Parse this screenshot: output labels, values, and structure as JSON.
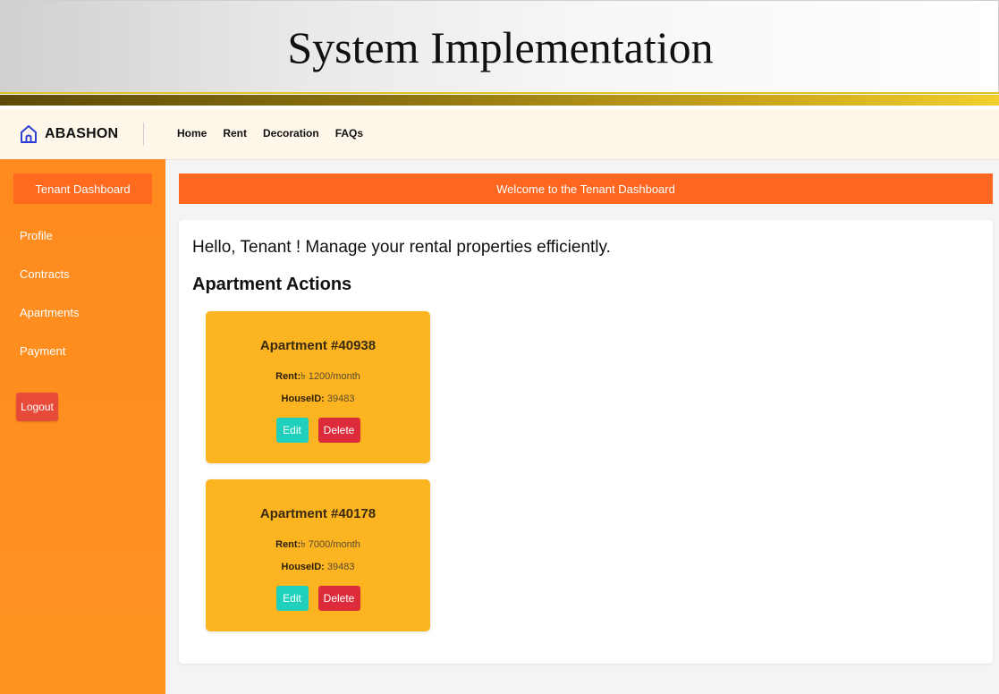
{
  "slide": {
    "title": "System Implementation"
  },
  "brand": {
    "name": "ABASHON",
    "icon": "home-icon"
  },
  "nav": {
    "links": [
      "Home",
      "Rent",
      "Decoration",
      "FAQs"
    ]
  },
  "sidebar": {
    "title": "Tenant Dashboard",
    "items": [
      "Profile",
      "Contracts",
      "Apartments",
      "Payment"
    ],
    "logout": "Logout"
  },
  "welcome": "Welcome to the Tenant Dashboard",
  "main": {
    "greeting": "Hello, Tenant ! Manage your rental properties efficiently.",
    "section_title": "Apartment Actions"
  },
  "apartments": [
    {
      "title": "Apartment #40938",
      "rent_label": "Rent:",
      "rent_value": "৳ 1200/month",
      "house_label": "HouseID:",
      "house_value": "39483",
      "edit": "Edit",
      "delete": "Delete"
    },
    {
      "title": "Apartment #40178",
      "rent_label": "Rent:",
      "rent_value": "৳ 7000/month",
      "house_label": "HouseID:",
      "house_value": "39483",
      "edit": "Edit",
      "delete": "Delete"
    }
  ],
  "colors": {
    "sidebar": "#ff8a1f",
    "accent_orange": "#ff6620",
    "card": "#fcb420",
    "edit_button": "#1fd1bd",
    "delete_button": "#dc2b3b",
    "logout_button": "#e84a3a"
  }
}
